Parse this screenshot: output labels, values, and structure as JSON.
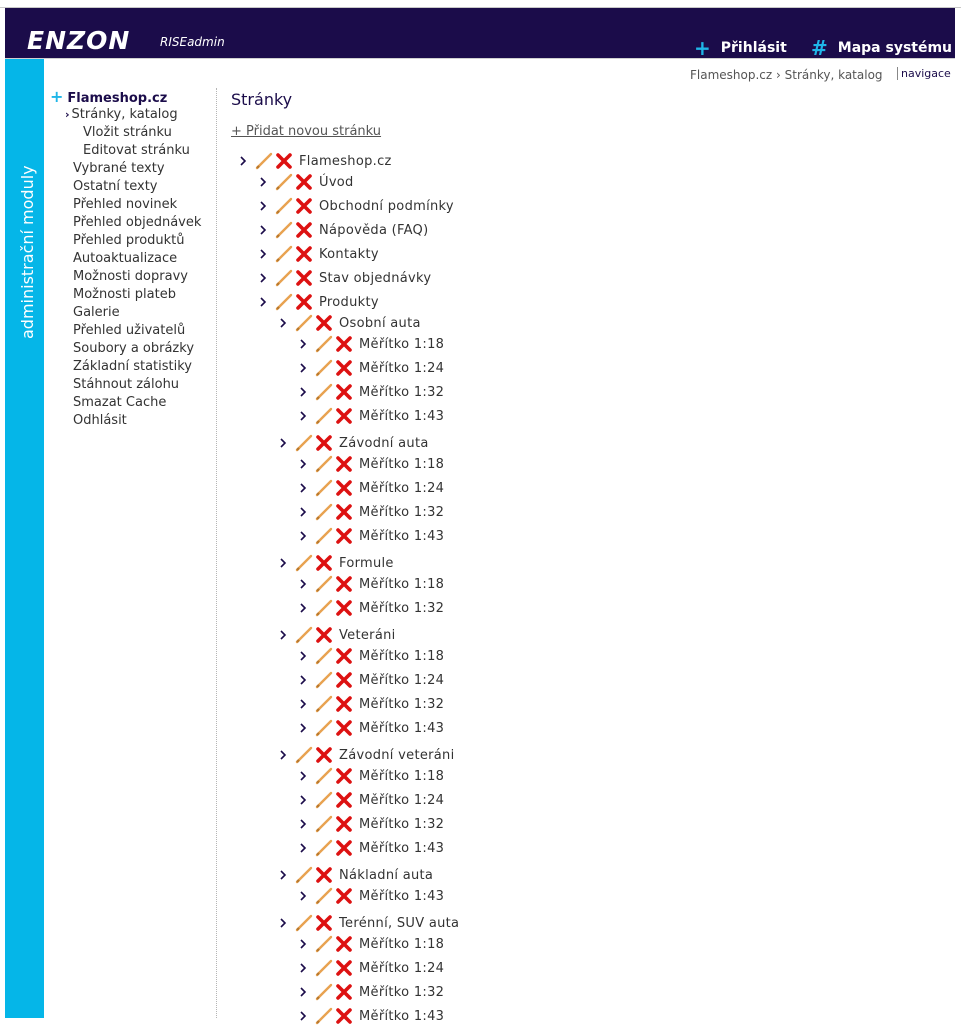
{
  "header": {
    "logo_text": "ENZON",
    "logo_sub": "RISEadmin",
    "login_icon": "+",
    "login_label": "Přihlásit",
    "sitemap_icon": "#",
    "sitemap_label": "Mapa systému"
  },
  "sidebar": {
    "title": "administrační moduly",
    "root": "Flameshop.cz",
    "items": [
      {
        "label": "Stránky, katalog",
        "level": 1,
        "current": true
      },
      {
        "label": "Vložit stránku",
        "level": 2
      },
      {
        "label": "Editovat stránku",
        "level": 2
      },
      {
        "label": "Vybrané texty",
        "level": 1
      },
      {
        "label": "Ostatní texty",
        "level": 1
      },
      {
        "label": "Přehled novinek",
        "level": 1
      },
      {
        "label": "Přehled objednávek",
        "level": 1
      },
      {
        "label": "Přehled produktů",
        "level": 1
      },
      {
        "label": "Autoaktualizace",
        "level": 1
      },
      {
        "label": "Možnosti dopravy",
        "level": 1
      },
      {
        "label": "Možnosti plateb",
        "level": 1
      },
      {
        "label": "Galerie",
        "level": 1
      },
      {
        "label": "Přehled uživatelů",
        "level": 1
      },
      {
        "label": "Soubory a obrázky",
        "level": 1
      },
      {
        "label": "Základní statistiky",
        "level": 1
      },
      {
        "label": "Stáhnout zálohu",
        "level": 1
      },
      {
        "label": "Smazat Cache",
        "level": 1
      },
      {
        "label": "Odhlásit",
        "level": 1
      }
    ]
  },
  "breadcrumb": {
    "path": "Flameshop.cz › Stránky, katalog",
    "nav_label": "navigace"
  },
  "main": {
    "title": "Stránky",
    "add_link": "+ Přidat novou stránku",
    "icons": {
      "expand": "chevron-right-icon",
      "edit": "pencil-icon",
      "delete": "red-x-icon"
    },
    "tree": [
      {
        "label": "Flameshop.cz",
        "level": 0
      },
      {
        "label": "Úvod",
        "level": 1
      },
      {
        "label": "Obchodní podmínky",
        "level": 1
      },
      {
        "label": "Nápověda (FAQ)",
        "level": 1
      },
      {
        "label": "Kontakty",
        "level": 1
      },
      {
        "label": "Stav objednávky",
        "level": 1
      },
      {
        "label": "Produkty",
        "level": 1
      },
      {
        "label": "Osobní auta",
        "level": 2
      },
      {
        "label": "Měřítko 1:18",
        "level": 3
      },
      {
        "label": "Měřítko 1:24",
        "level": 3
      },
      {
        "label": "Měřítko 1:32",
        "level": 3
      },
      {
        "label": "Měřítko 1:43",
        "level": 3
      },
      {
        "label": "Závodní auta",
        "level": 2
      },
      {
        "label": "Měřítko 1:18",
        "level": 3
      },
      {
        "label": "Měřítko 1:24",
        "level": 3
      },
      {
        "label": "Měřítko 1:32",
        "level": 3
      },
      {
        "label": "Měřítko 1:43",
        "level": 3
      },
      {
        "label": "Formule",
        "level": 2
      },
      {
        "label": "Měřítko 1:18",
        "level": 3
      },
      {
        "label": "Měřítko 1:32",
        "level": 3
      },
      {
        "label": "Veteráni",
        "level": 2
      },
      {
        "label": "Měřítko 1:18",
        "level": 3
      },
      {
        "label": "Měřítko 1:24",
        "level": 3
      },
      {
        "label": "Měřítko 1:32",
        "level": 3
      },
      {
        "label": "Měřítko 1:43",
        "level": 3
      },
      {
        "label": "Závodní veteráni",
        "level": 2
      },
      {
        "label": "Měřítko 1:18",
        "level": 3
      },
      {
        "label": "Měřítko 1:24",
        "level": 3
      },
      {
        "label": "Měřítko 1:32",
        "level": 3
      },
      {
        "label": "Měřítko 1:43",
        "level": 3
      },
      {
        "label": "Nákladní auta",
        "level": 2
      },
      {
        "label": "Měřítko 1:43",
        "level": 3
      },
      {
        "label": "Terénní, SUV auta",
        "level": 2
      },
      {
        "label": "Měřítko 1:18",
        "level": 3
      },
      {
        "label": "Měřítko 1:24",
        "level": 3
      },
      {
        "label": "Měřítko 1:32",
        "level": 3
      },
      {
        "label": "Měřítko 1:43",
        "level": 3
      }
    ]
  },
  "colors": {
    "header_bg": "#1b0c4a",
    "accent": "#1fb6e8",
    "sidebar_bar": "#05b6e8",
    "delete_red": "#dd1111",
    "edit_orange": "#e8a250"
  }
}
